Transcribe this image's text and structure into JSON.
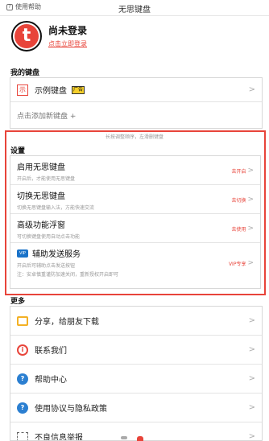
{
  "topbar": {
    "help": "使用帮助",
    "title": "无思键盘"
  },
  "profile": {
    "logo_letter": "t",
    "name": "尚未登录",
    "login_link": "点击立即登录"
  },
  "my_keyboard": {
    "section_title": "我的键盘",
    "example": {
      "icon_text": "示",
      "label": "示例键盘",
      "badge": "广告"
    },
    "add_label": "点击添加新键盘 +"
  },
  "settings": {
    "hint": "长按调整顺序，左滑删键盘",
    "section_title": "设置",
    "rows": [
      {
        "title": "启用无思键盘",
        "desc": "开启后，才能使用无思键盘",
        "action": "去开启"
      },
      {
        "title": "切换无思键盘",
        "desc": "切换无思键盘输入法，方能快速交流",
        "action": "去切换"
      },
      {
        "title": "高级功能浮窗",
        "desc": "可切换键盘使用自动点击功能",
        "action": "去使用"
      },
      {
        "title": "辅助发送服务",
        "desc": "开启后可辅助点击发送按钮",
        "desc2": "注：安卓慎重谨防加速关闭，重新授权开启即可",
        "action": "VIP专享",
        "icon_text": "VIP"
      }
    ]
  },
  "more": {
    "section_title": "更多",
    "items": [
      {
        "label": "分享，给朋友下载",
        "icon": "share-icon"
      },
      {
        "label": "联系我们",
        "icon": "contact-icon"
      },
      {
        "label": "帮助中心",
        "icon": "help-icon"
      },
      {
        "label": "使用协议与隐私政策",
        "icon": "help-icon"
      },
      {
        "label": "不良信息举报",
        "icon": "report-icon"
      }
    ]
  },
  "colors": {
    "accent": "#e8443a",
    "help_blue": "#2b7fd1",
    "share_orange": "#f3b125"
  }
}
